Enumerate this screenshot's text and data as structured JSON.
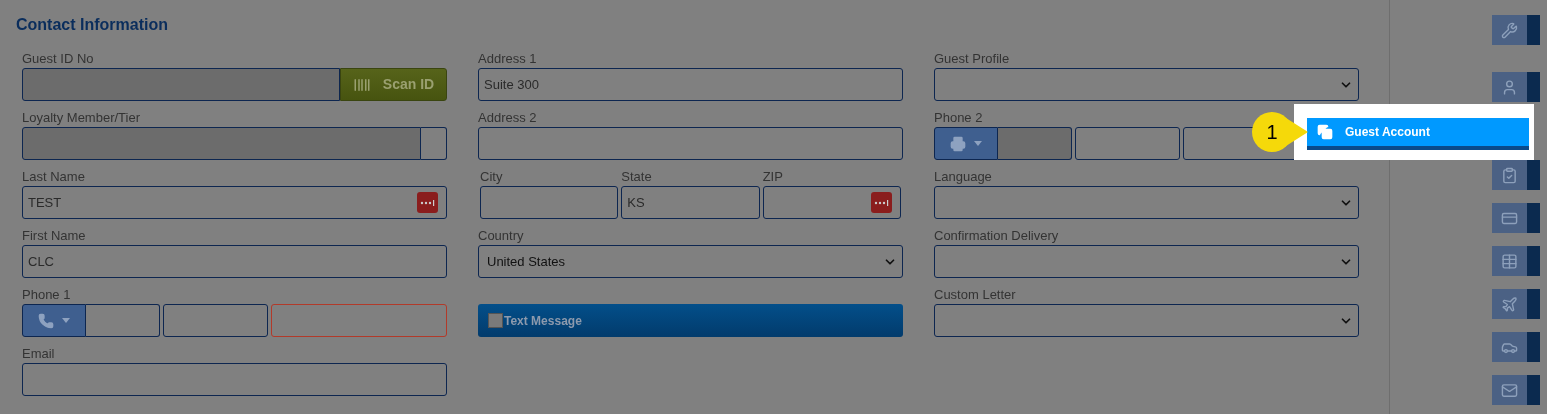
{
  "section_title": "Contact Information",
  "columns": [
    [
      {
        "kind": "scan",
        "label": "Guest ID No",
        "button": "Scan ID",
        "disabled": true
      },
      {
        "kind": "split",
        "label": "Loyalty Member/Tier",
        "disabled": true
      },
      {
        "kind": "lookup",
        "label": "Last Name",
        "value": "TEST"
      },
      {
        "kind": "text",
        "label": "First Name",
        "value": "CLC"
      },
      {
        "kind": "phone",
        "label": "Phone 1",
        "parts": [
          {
            "disabled": false,
            "invalid": false
          },
          {
            "disabled": false,
            "invalid": false
          },
          {
            "disabled": false,
            "invalid": true
          }
        ]
      },
      {
        "kind": "text",
        "label": "Email"
      }
    ],
    [
      {
        "kind": "text",
        "label": "Address 1",
        "value": "Suite 300"
      },
      {
        "kind": "text",
        "label": "Address 2"
      },
      {
        "kind": "triple",
        "subfields": [
          {
            "kind": "text",
            "label": "City"
          },
          {
            "kind": "text",
            "label": "State",
            "value": "KS"
          },
          {
            "kind": "lookup",
            "label": "ZIP"
          }
        ]
      },
      {
        "kind": "select",
        "label": "Country",
        "value": "United States"
      },
      {
        "kind": "checkbar",
        "label": "Text Message",
        "checked": false
      }
    ],
    [
      {
        "kind": "select",
        "label": "Guest Profile"
      },
      {
        "kind": "fax",
        "label": "Phone 2",
        "parts": [
          {
            "disabled": true,
            "invalid": false
          },
          {
            "disabled": false,
            "invalid": false
          },
          {
            "disabled": false,
            "invalid": false
          }
        ]
      },
      {
        "kind": "select",
        "label": "Language"
      },
      {
        "kind": "select",
        "label": "Confirmation Delivery"
      },
      {
        "kind": "select",
        "label": "Custom Letter"
      }
    ]
  ],
  "tour": {
    "step": "1",
    "label": "Guest Account"
  }
}
